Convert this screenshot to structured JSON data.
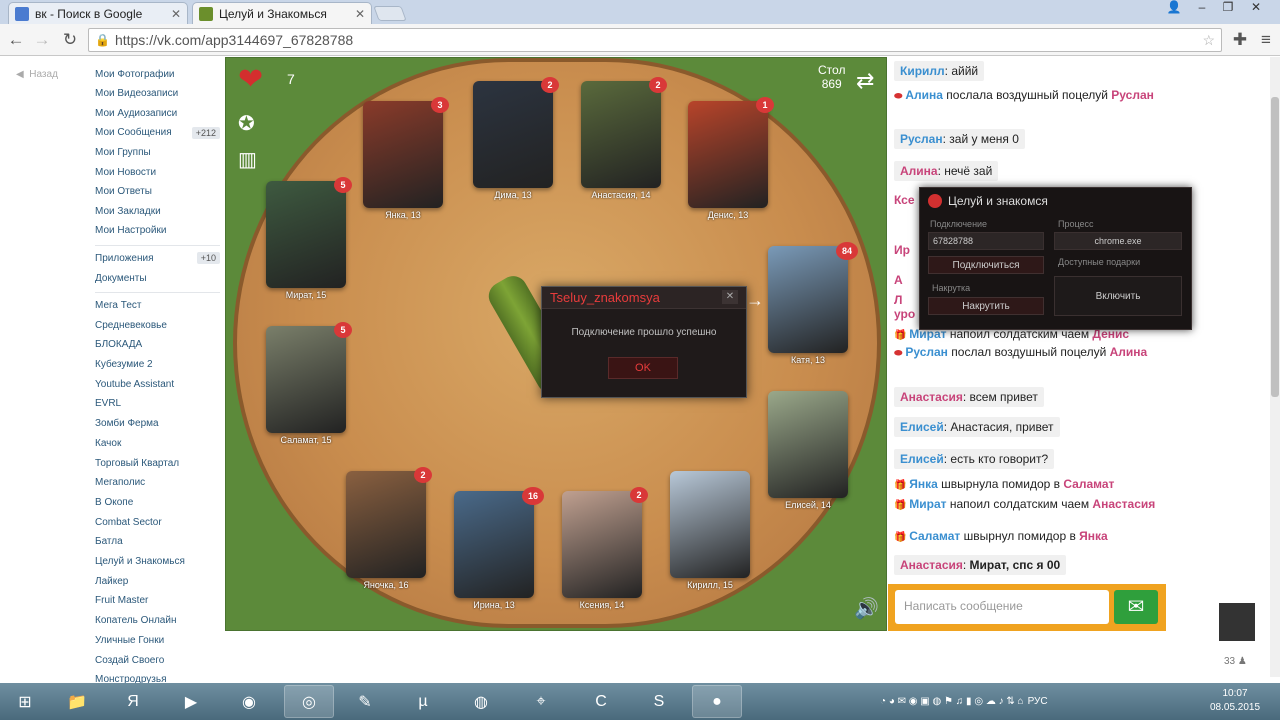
{
  "browser": {
    "tabs": [
      {
        "label": "вк - Поиск в Google",
        "icon_color": "#4a7bd0"
      },
      {
        "label": "Целуй и Знакомься",
        "icon_color": "#6b8f2c"
      }
    ],
    "url": "https://vk.com/app3144697_67828788"
  },
  "sidebar": {
    "back_label": "Назад",
    "items": [
      {
        "label": "Мои Фотографии"
      },
      {
        "label": "Мои Видеозаписи"
      },
      {
        "label": "Мои Аудиозаписи"
      },
      {
        "label": "Мои Сообщения",
        "badge": "+212"
      },
      {
        "label": "Мои Группы"
      },
      {
        "label": "Мои Новости"
      },
      {
        "label": "Мои Ответы"
      },
      {
        "label": "Мои Закладки"
      },
      {
        "label": "Мои Настройки"
      }
    ],
    "items2": [
      {
        "label": "Приложения",
        "badge": "+10"
      },
      {
        "label": "Документы"
      }
    ],
    "apps": [
      "Мега Тест",
      "Средневековье",
      "БЛОКАДА",
      "Кубезумие 2",
      "Youtube Assistant",
      "EVRL",
      "Зомби Ферма",
      "Качок",
      "Торговый Квартал",
      "Мегаполис",
      "В Окопе",
      "Combat Sector",
      "Батла",
      "Целуй и Знакомься",
      "Лайкер",
      "Fruit Master",
      "Копатель Онлайн",
      "Уличные Гонки",
      "Создай Своего",
      "Монстродрузья"
    ]
  },
  "game": {
    "hearts_count": "7",
    "table_label": "Стол",
    "table_number": "869",
    "players": [
      {
        "name": "Янка, 13",
        "badge": "3",
        "color": "#8a3b2a"
      },
      {
        "name": "Дима, 13",
        "badge": "2",
        "color": "#2c3440"
      },
      {
        "name": "Анастасия, 14",
        "badge": "2",
        "color": "#5a6a3c"
      },
      {
        "name": "Денис, 13",
        "badge": "1",
        "color": "#b8442a"
      },
      {
        "name": "Мират, 15",
        "badge": "5",
        "color": "#3e5a40"
      },
      {
        "name": "Катя, 13",
        "badge": "84",
        "color": "#7a9ab8"
      },
      {
        "name": "Саламат, 15",
        "badge": "5",
        "color": "#7a7f6a"
      },
      {
        "name": "Елисей, 14",
        "badge": "",
        "color": "#9aa88a"
      },
      {
        "name": "Яночка, 16",
        "badge": "2",
        "color": "#8a6040"
      },
      {
        "name": "Ирина, 13",
        "badge": "16",
        "color": "#4a6a8a"
      },
      {
        "name": "Ксения, 14",
        "badge": "2",
        "color": "#c0a090"
      },
      {
        "name": "Кирилл, 15",
        "badge": "",
        "color": "#b8c8d8"
      }
    ],
    "dialog": {
      "title": "Tseluy_znakomsya",
      "message": "Подключение прошло успешно",
      "ok": "OK"
    }
  },
  "chat": {
    "messages": [
      {
        "name": "Кирилл",
        "text": "аййй"
      },
      {
        "actor": "Алина",
        "action": "послала воздушный поцелуй",
        "target": "Руслан"
      },
      {
        "name": "Руслан",
        "text": "зай у меня 0"
      },
      {
        "name": "Алина",
        "text": "нечё зай"
      },
      {
        "frag": "Ксе"
      },
      {
        "frag": "Ир"
      },
      {
        "frag": "А"
      },
      {
        "frag": "Л"
      },
      {
        "frag": "уро"
      },
      {
        "actor": "Мират",
        "action": "напоил солдатским чаем",
        "target": "Денис"
      },
      {
        "actor": "Руслан",
        "action": "послал воздушный поцелуй",
        "target": "Алина"
      },
      {
        "name": "Анастасия",
        "text": "всем привет"
      },
      {
        "name": "Елисей",
        "text": "Анастасия, привет"
      },
      {
        "name": "Елисей",
        "text": "есть кто говорит?"
      },
      {
        "actor": "Янка",
        "action": "швырнула помидор в",
        "target": "Саламат"
      },
      {
        "actor": "Мират",
        "action": "напоил солдатским чаем",
        "target": "Анастасия"
      },
      {
        "actor": "Саламат",
        "action": "швырнул помидор в",
        "target": "Янка"
      },
      {
        "name": "Анастасия",
        "text": "Мират, спс я 00"
      }
    ],
    "input_placeholder": "Написать сообщение"
  },
  "overlay": {
    "title": "Целуй и знакомся",
    "conn_label": "Подключение",
    "conn_value": "67828788",
    "process_label": "Процесс",
    "process_value": "chrome.exe",
    "connect_btn": "Подключиться",
    "gifts_label": "Доступные подарки",
    "cheat_label": "Накрутка",
    "cheat_btn": "Накрутить",
    "enable_btn": "Включить"
  },
  "right_widget": {
    "count": "33"
  },
  "taskbar": {
    "lang": "РУС",
    "time": "10:07",
    "date": "08.05.2015"
  }
}
